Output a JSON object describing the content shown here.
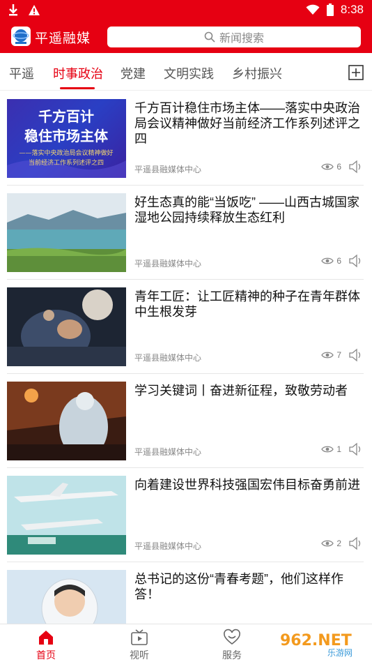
{
  "status_bar": {
    "time": "8:38",
    "icons": [
      "download-icon",
      "warning-icon",
      "wifi-icon",
      "battery-icon"
    ]
  },
  "header": {
    "app_title": "平遥融媒",
    "search_placeholder": "新闻搜索"
  },
  "tabs": [
    {
      "label": "平遥",
      "active": false
    },
    {
      "label": "时事政治",
      "active": true
    },
    {
      "label": "党建",
      "active": false
    },
    {
      "label": "文明实践",
      "active": false
    },
    {
      "label": "乡村振兴",
      "active": false
    }
  ],
  "articles": [
    {
      "title": "千方百计稳住市场主体——落实中央政治局会议精神做好当前经济工作系列述评之四",
      "source": "平遥县融媒体中心",
      "views": "6",
      "thumb_text": {
        "line1": "千方百计",
        "line2": "稳住市场主体",
        "line3": "——落实中央政治局会议精神做好",
        "line4": "当前经济工作系列述评之四"
      }
    },
    {
      "title": "好生态真的能“当饭吃” ——山西古城国家湿地公园持续释放生态红利",
      "source": "平遥县融媒体中心",
      "views": "6"
    },
    {
      "title": "青年工匠：让工匠精神的种子在青年群体中生根发芽",
      "source": "平遥县融媒体中心",
      "views": "7"
    },
    {
      "title": "学习关键词丨奋进新征程，致敬劳动者",
      "source": "平遥县融媒体中心",
      "views": "1"
    },
    {
      "title": "向着建设世界科技强国宏伟目标奋勇前进",
      "source": "平遥县融媒体中心",
      "views": "2"
    },
    {
      "title": "总书记的这份“青春考题”，他们这样作答！",
      "source": "",
      "views": ""
    }
  ],
  "bottom_nav": [
    {
      "label": "首页",
      "active": true,
      "icon": "home-icon"
    },
    {
      "label": "视听",
      "active": false,
      "icon": "tv-icon"
    },
    {
      "label": "服务",
      "active": false,
      "icon": "heart-icon"
    }
  ],
  "watermark": {
    "brand": "962.NET",
    "sub": "乐游网"
  },
  "colors": {
    "brand_red": "#e60012"
  }
}
